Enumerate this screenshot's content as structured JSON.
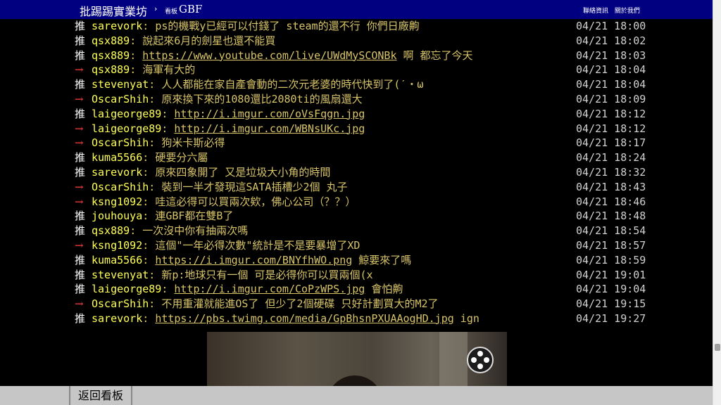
{
  "header": {
    "site_title": "批踢踢實業坊",
    "separator": "›",
    "board_label": "看板",
    "board_name": "GBF",
    "links": [
      "聯絡資訊",
      "關於我們"
    ]
  },
  "comments": [
    {
      "tag": "推",
      "type": "push",
      "user": "sarevork",
      "content": "ps的機戰y已經可以付錢了 steam的還不行 你們日廠齁",
      "link": "",
      "time": "04/21 18:00"
    },
    {
      "tag": "推",
      "type": "push",
      "user": "qsx889",
      "content": "說起來6月的劍星也還不能買",
      "link": "",
      "time": "04/21 18:02"
    },
    {
      "tag": "推",
      "type": "push",
      "user": "qsx889",
      "content": "",
      "link": "https://www.youtube.com/live/UWdMySCONBk",
      "after": " 啊 都忘了今天",
      "time": "04/21 18:03"
    },
    {
      "tag": "→",
      "type": "arrow",
      "user": "qsx889",
      "content": "海軍有大的",
      "link": "",
      "time": "04/21 18:04"
    },
    {
      "tag": "推",
      "type": "push",
      "user": "stevenyat",
      "content": "人人都能在家自產會動的二次元老婆的時代快到了(ˊ・ω",
      "link": "",
      "time": "04/21 18:04"
    },
    {
      "tag": "→",
      "type": "arrow",
      "user": "OscarShih",
      "content": "原來換下來的1080還比2080ti的風扇還大",
      "link": "",
      "time": "04/21 18:09"
    },
    {
      "tag": "推",
      "type": "push",
      "user": "laigeorge89",
      "content": "",
      "link": "http://i.imgur.com/oVsFqgn.jpg",
      "after": "",
      "time": "04/21 18:12"
    },
    {
      "tag": "→",
      "type": "arrow",
      "user": "laigeorge89",
      "content": "",
      "link": "http://i.imgur.com/WBNsUKc.jpg",
      "after": "",
      "time": "04/21 18:12"
    },
    {
      "tag": "→",
      "type": "arrow",
      "user": "OscarShih",
      "content": "狗米卡斯必得",
      "link": "",
      "time": "04/21 18:17"
    },
    {
      "tag": "推",
      "type": "push",
      "user": "kuma5566",
      "content": "硬要分六屬",
      "link": "",
      "time": "04/21 18:24"
    },
    {
      "tag": "推",
      "type": "push",
      "user": "sarevork",
      "content": "原來四象開了 又是垃圾大小角的時間",
      "link": "",
      "time": "04/21 18:32"
    },
    {
      "tag": "→",
      "type": "arrow",
      "user": "OscarShih",
      "content": "裝到一半才發現這SATA插槽少2個 丸子",
      "link": "",
      "time": "04/21 18:43"
    },
    {
      "tag": "→",
      "type": "arrow",
      "user": "ksng1092",
      "content": "哇這必得可以買兩次欸，佛心公司（？？）",
      "link": "",
      "time": "04/21 18:46"
    },
    {
      "tag": "推",
      "type": "push",
      "user": "jouhouya",
      "content": "連GBF都在雙B了",
      "link": "",
      "time": "04/21 18:48"
    },
    {
      "tag": "推",
      "type": "push",
      "user": "qsx889",
      "content": "一次沒中你有抽兩次嗎",
      "link": "",
      "time": "04/21 18:54"
    },
    {
      "tag": "→",
      "type": "arrow",
      "user": "ksng1092",
      "content": "這個\"一年必得次數\"統計是不是要暴增了XD",
      "link": "",
      "time": "04/21 18:57"
    },
    {
      "tag": "推",
      "type": "push",
      "user": "kuma5566",
      "content": "",
      "link": "https://i.imgur.com/BNYfhWO.png",
      "after": " 鯨要來了嗎",
      "time": "04/21 18:59"
    },
    {
      "tag": "推",
      "type": "push",
      "user": "stevenyat",
      "content": "新p:地球只有一個 可是必得你可以買兩個(x",
      "link": "",
      "time": "04/21 19:01"
    },
    {
      "tag": "推",
      "type": "push",
      "user": "laigeorge89",
      "content": "",
      "link": "http://i.imgur.com/CoPzWPS.jpg",
      "after": " 會怕齁",
      "time": "04/21 19:04"
    },
    {
      "tag": "→",
      "type": "arrow",
      "user": "OscarShih",
      "content": "不用重灌就能進OS了 但少了2個硬碟 只好計劃買大的M2了",
      "link": "",
      "time": "04/21 19:15"
    },
    {
      "tag": "推",
      "type": "push",
      "user": "sarevork",
      "content": "",
      "link": "https://pbs.twimg.com/media/GpBhsnPXUAAogHD.jpg",
      "after": " ign",
      "time": "04/21 19:27"
    }
  ],
  "footer": {
    "back_label": "返回看板"
  },
  "icons": {
    "gamepad": "gamepad-icon"
  }
}
